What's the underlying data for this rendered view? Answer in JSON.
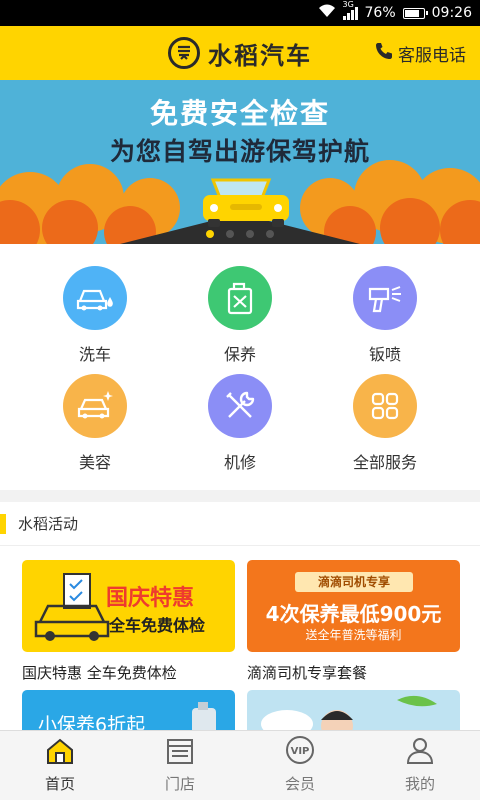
{
  "status_bar": {
    "network": "3G",
    "battery": "76%",
    "battery_level": 0.76,
    "time": "09:26"
  },
  "header": {
    "title": "水稻汽车",
    "service_label": "客服电话"
  },
  "banner": {
    "title": "免费安全检查",
    "subtitle": "为您自驾出游保驾护航",
    "slides": 4,
    "active_slide": 0
  },
  "services": [
    {
      "label": "洗车",
      "icon": "car-wash-icon",
      "color": "#4fb3f6"
    },
    {
      "label": "保养",
      "icon": "oil-can-icon",
      "color": "#3ec873"
    },
    {
      "label": "钣喷",
      "icon": "spray-gun-icon",
      "color": "#8b8ef6"
    },
    {
      "label": "美容",
      "icon": "car-sparkle-icon",
      "color": "#f8b44a"
    },
    {
      "label": "机修",
      "icon": "wrench-icon",
      "color": "#8b8ef6"
    },
    {
      "label": "全部服务",
      "icon": "grid-icon",
      "color": "#f8b44a"
    }
  ],
  "activities": {
    "title": "水稻活动",
    "cards": [
      {
        "label": "国庆特惠 全车免费体检",
        "headline": "国庆特惠",
        "subline": "全车免费体检"
      },
      {
        "label": "滴滴司机专享套餐",
        "tag": "滴滴司机专享",
        "headline": "4次保养最低900元",
        "subline": "送全年普洗等福利"
      },
      {
        "headline": "小保养6折起"
      },
      {
        "headline": ""
      }
    ]
  },
  "tabbar": [
    {
      "label": "首页",
      "icon": "home-icon",
      "active": true
    },
    {
      "label": "门店",
      "icon": "store-icon",
      "active": false
    },
    {
      "label": "会员",
      "icon": "vip-icon",
      "active": false
    },
    {
      "label": "我的",
      "icon": "profile-icon",
      "active": false
    }
  ]
}
